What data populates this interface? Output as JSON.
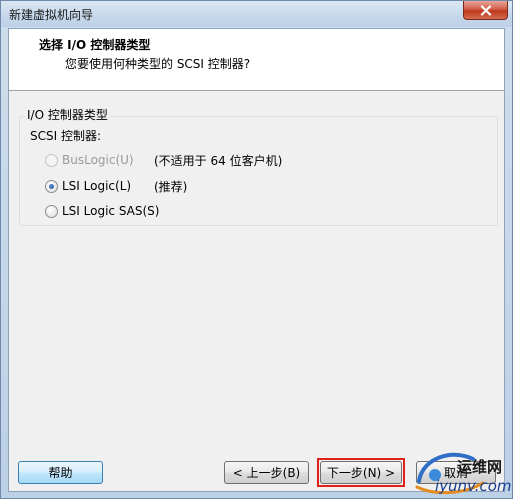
{
  "window": {
    "title": "新建虚拟机向导"
  },
  "header": {
    "title": "选择 I/O 控制器类型",
    "subtitle": "您要使用何种类型的 SCSI 控制器?"
  },
  "group": {
    "legend": "I/O 控制器类型",
    "scsi_label": "SCSI 控制器:",
    "options": [
      {
        "label": "BusLogic(U)",
        "note": "(不适用于 64 位客户机)",
        "checked": false,
        "disabled": true
      },
      {
        "label": "LSI Logic(L)",
        "note": "(推荐)",
        "checked": true,
        "disabled": false
      },
      {
        "label": "LSI Logic SAS(S)",
        "note": "",
        "checked": false,
        "disabled": false
      }
    ]
  },
  "footer": {
    "help_label": "帮助",
    "back_label": "< 上一步(B)",
    "next_label": "下一步(N) >",
    "cancel_label": "取消"
  },
  "watermark": {
    "top": "运维网",
    "bottom": "iyunv.com"
  },
  "colors": {
    "highlight": "#e0211a",
    "close_button": "#c0391f"
  }
}
